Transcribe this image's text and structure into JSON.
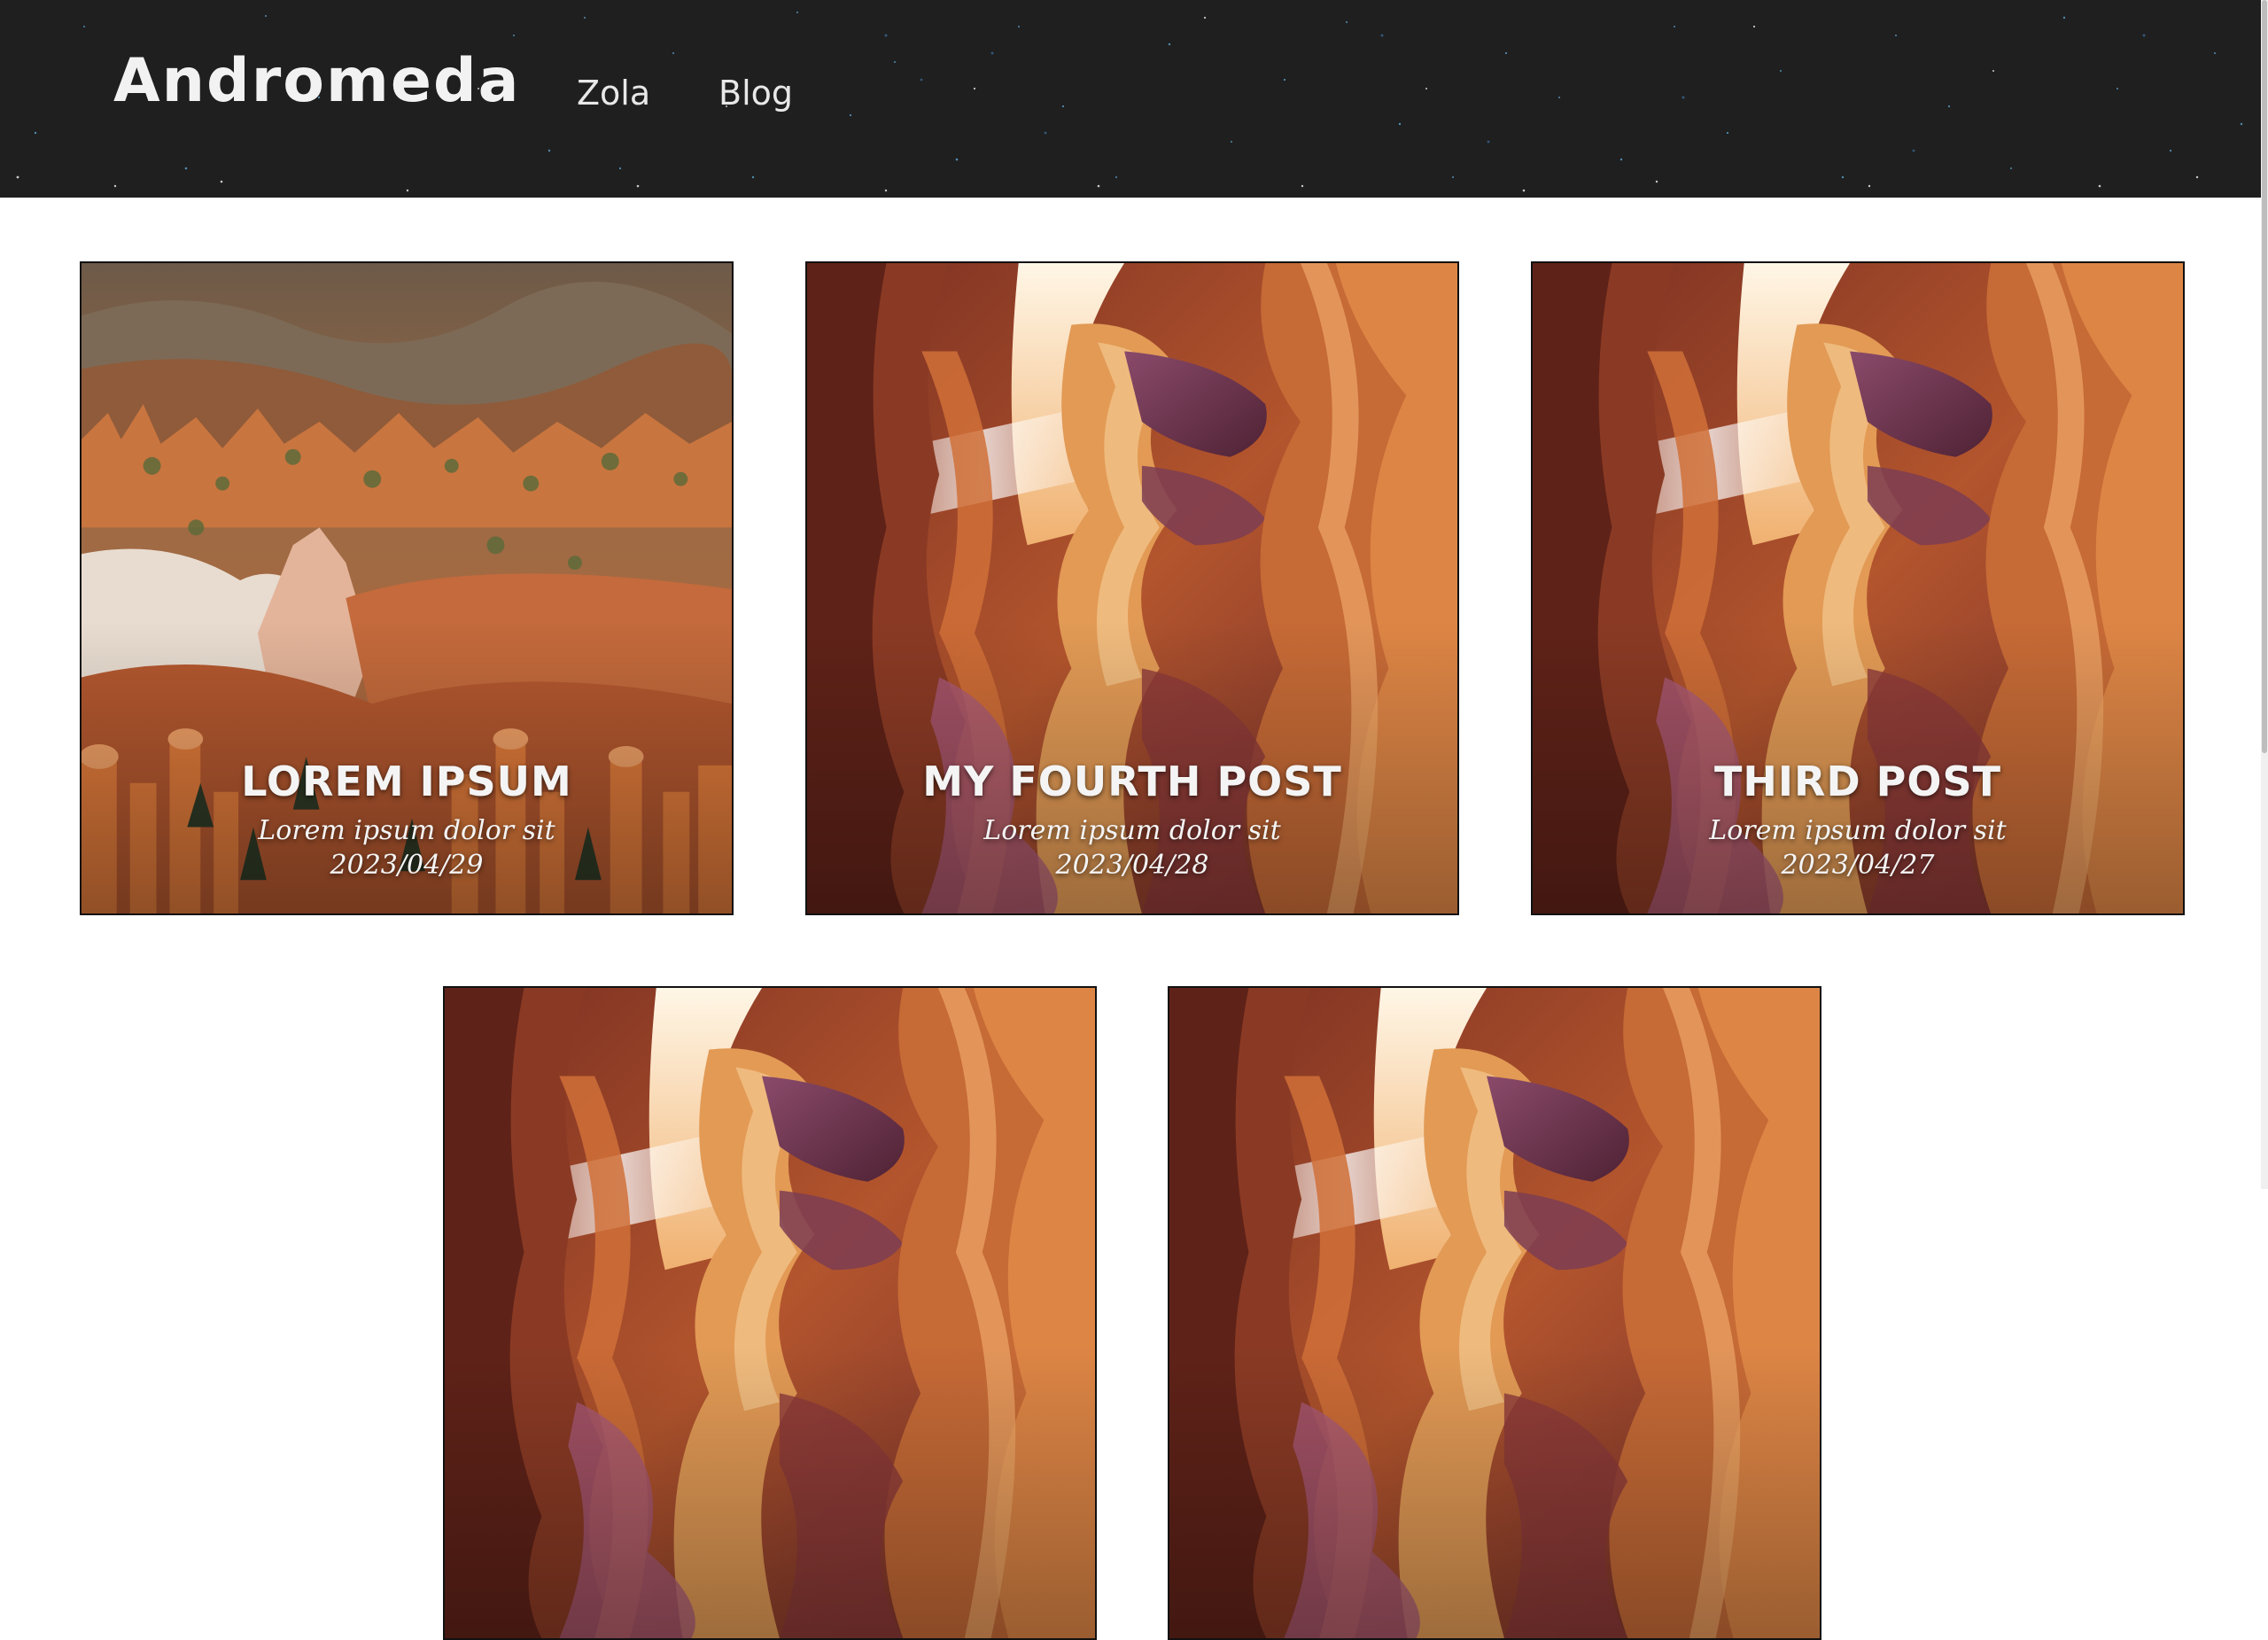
{
  "header": {
    "logo": "Andromeda",
    "nav": [
      {
        "label": "Zola"
      },
      {
        "label": "Blog"
      }
    ],
    "background_color": "#1f1f1f"
  },
  "posts": [
    {
      "title": "LOREM IPSUM",
      "subtitle": "Lorem ipsum dolor sit",
      "date": "2023/04/29",
      "image": "hoodoo-canyon-landscape"
    },
    {
      "title": "MY FOURTH POST",
      "subtitle": "Lorem ipsum dolor sit",
      "date": "2023/04/28",
      "image": "slot-canyon"
    },
    {
      "title": "THIRD POST",
      "subtitle": "Lorem ipsum dolor sit",
      "date": "2023/04/27",
      "image": "slot-canyon"
    },
    {
      "title": "",
      "subtitle": "",
      "date": "",
      "image": "slot-canyon"
    },
    {
      "title": "",
      "subtitle": "",
      "date": "",
      "image": "slot-canyon"
    }
  ]
}
